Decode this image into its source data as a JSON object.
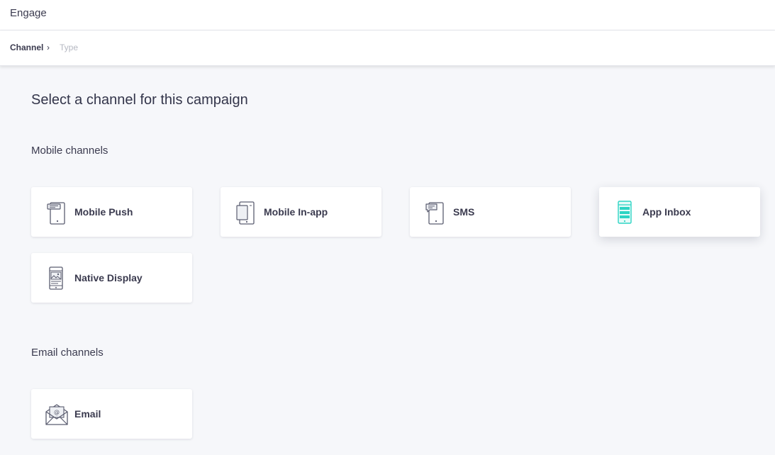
{
  "header": {
    "app_title": "Engage"
  },
  "breadcrumb": {
    "current": "Channel",
    "separator": "›",
    "next": "Type"
  },
  "main": {
    "title": "Select a channel for this campaign",
    "sections": [
      {
        "heading": "Mobile channels",
        "channels": [
          {
            "label": "Mobile Push",
            "icon": "mobile-push-icon"
          },
          {
            "label": "Mobile In-app",
            "icon": "mobile-in-app-icon"
          },
          {
            "label": "SMS",
            "icon": "sms-icon"
          },
          {
            "label": "App Inbox",
            "icon": "app-inbox-icon",
            "accent": "#2dd4c4"
          },
          {
            "label": "Native Display",
            "icon": "native-display-icon"
          }
        ]
      },
      {
        "heading": "Email channels",
        "channels": [
          {
            "label": "Email",
            "icon": "email-icon"
          }
        ]
      }
    ]
  },
  "colors": {
    "page_bg": "#f6f7fa",
    "card_bg": "#ffffff",
    "text": "#3b3b4f",
    "muted": "#b5b8c2",
    "icon_stroke": "#5b5d70",
    "accent": "#2dd4c4"
  }
}
